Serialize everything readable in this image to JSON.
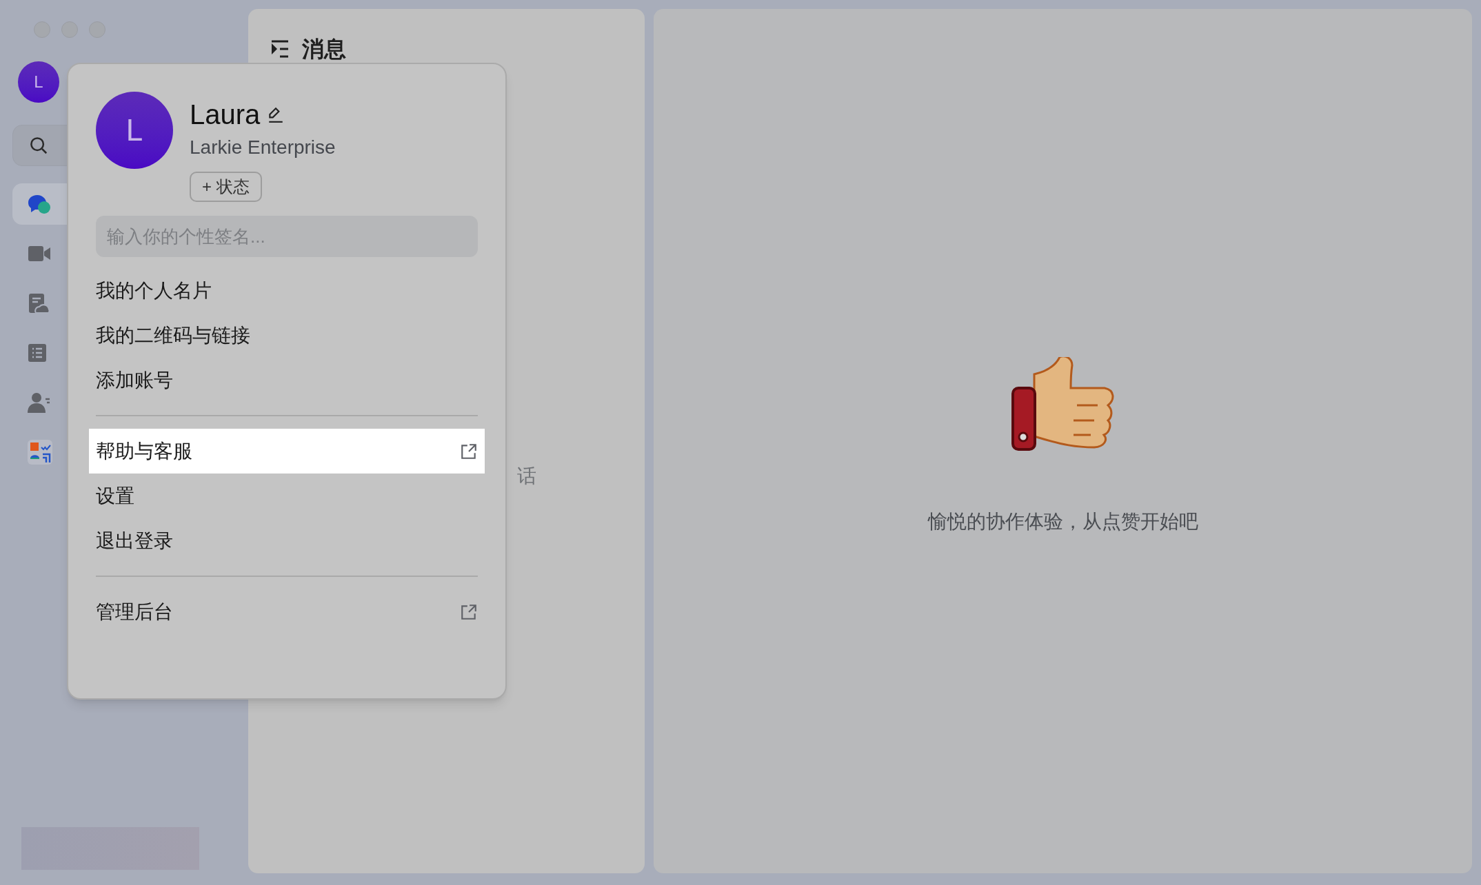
{
  "sidebar": {
    "avatar": "L",
    "nav_items": [
      {
        "selected": true
      },
      {
        "selected": false
      },
      {
        "selected": false
      },
      {
        "selected": false
      },
      {
        "selected": false
      },
      {
        "selected": false
      }
    ]
  },
  "messages_panel": {
    "title": "消息",
    "empty_hint": "话"
  },
  "main": {
    "empty_text": "愉悦的协作体验，从点赞开始吧"
  },
  "profile_menu": {
    "avatar": "L",
    "name": "Laura",
    "organization": "Larkie Enterprise",
    "status_button": "+ 状态",
    "signature": {
      "placeholder": "输入你的个性签名..."
    },
    "sections": [
      [
        {
          "label": "我的个人名片",
          "highlighted": false,
          "external": false
        },
        {
          "label": "我的二维码与链接",
          "highlighted": false,
          "external": false
        },
        {
          "label": "添加账号",
          "highlighted": false,
          "external": false
        }
      ],
      [
        {
          "label": "帮助与客服",
          "highlighted": true,
          "external": true
        },
        {
          "label": "设置",
          "highlighted": false,
          "external": false
        },
        {
          "label": "退出登录",
          "highlighted": false,
          "external": false
        }
      ],
      [
        {
          "label": "管理后台",
          "highlighted": false,
          "external": true
        }
      ]
    ]
  }
}
